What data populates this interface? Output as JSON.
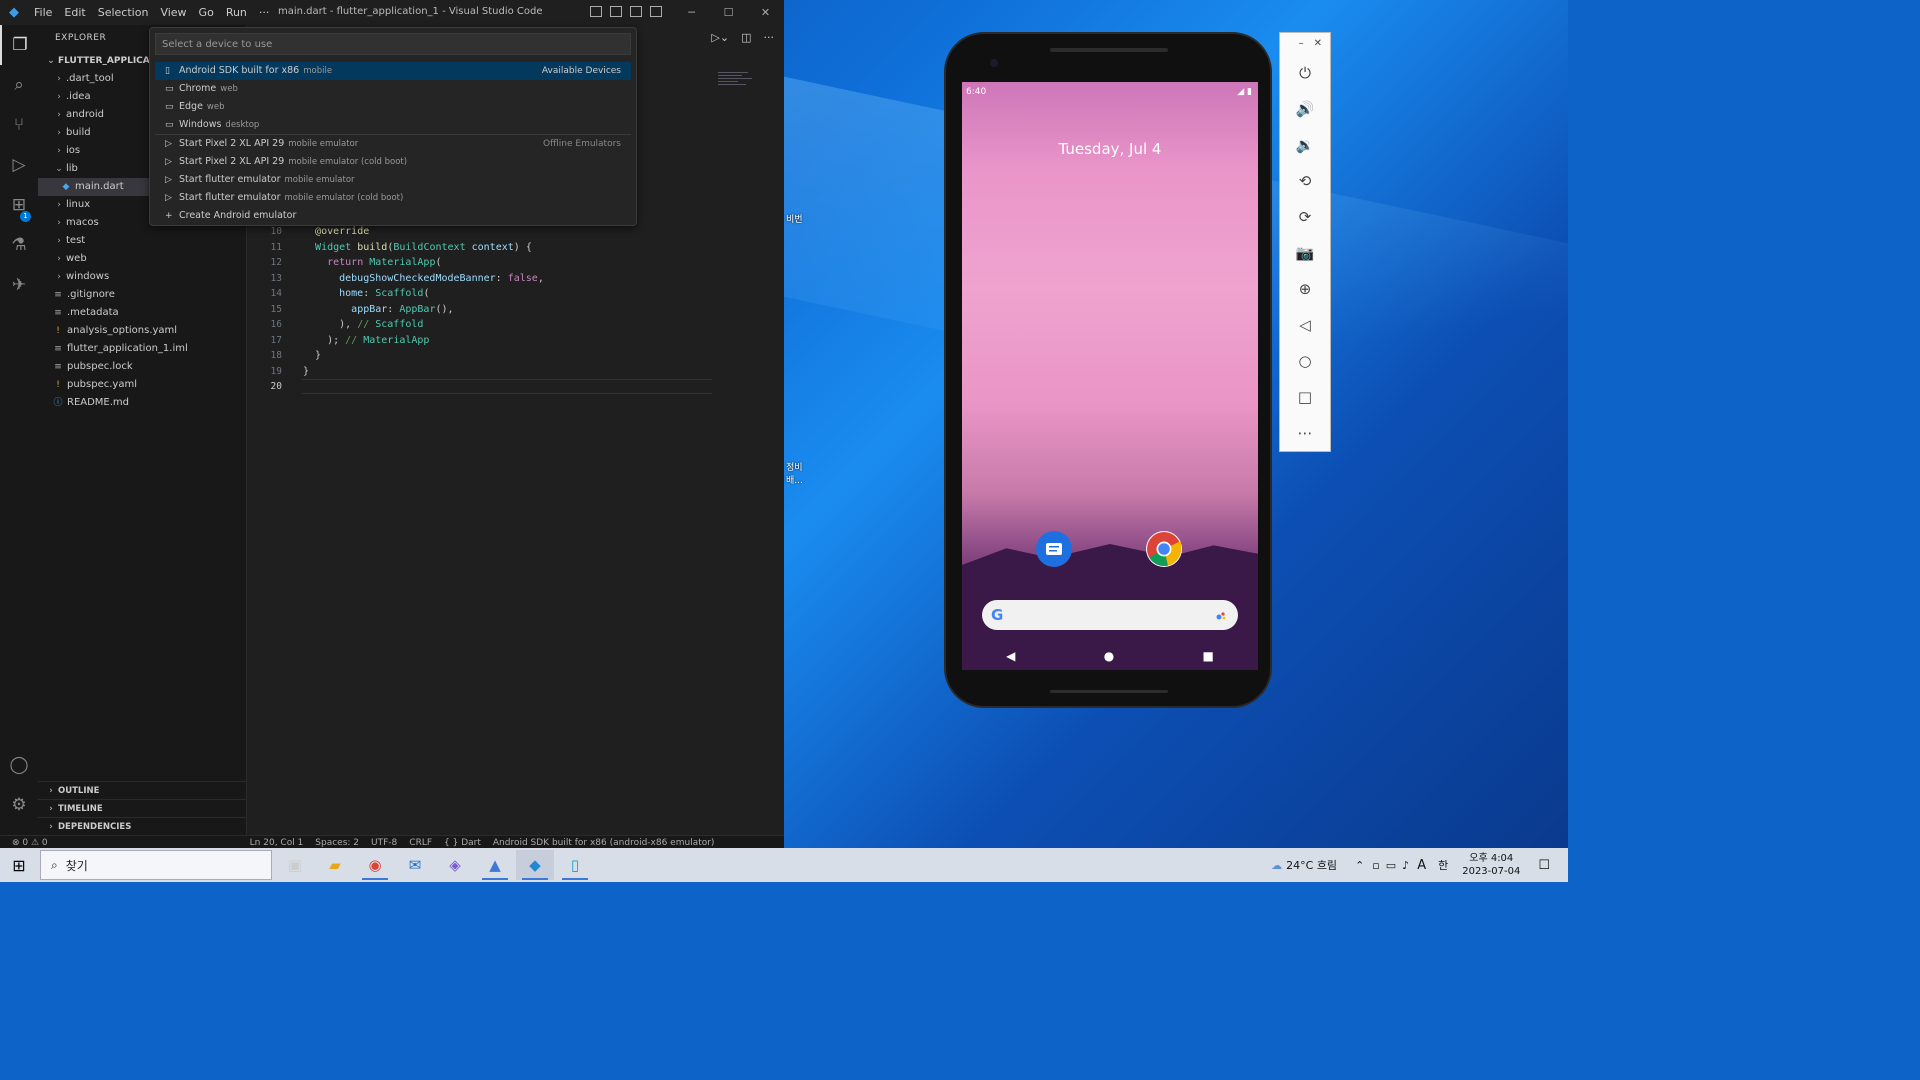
{
  "vscode": {
    "logo": "◆",
    "menu": [
      "File",
      "Edit",
      "Selection",
      "View",
      "Go",
      "Run",
      "···"
    ],
    "window_title": "main.dart - flutter_application_1 - Visual Studio Code",
    "sidebar": {
      "title": "EXPLORER",
      "project": "FLUTTER_APPLICATION_1",
      "items": [
        {
          "label": ".dart_tool",
          "type": "folder"
        },
        {
          "label": ".idea",
          "type": "folder"
        },
        {
          "label": "android",
          "type": "folder"
        },
        {
          "label": "build",
          "type": "folder"
        },
        {
          "label": "ios",
          "type": "folder"
        },
        {
          "label": "lib",
          "type": "folder-open"
        },
        {
          "label": "main.dart",
          "type": "dart"
        },
        {
          "label": "linux",
          "type": "folder"
        },
        {
          "label": "macos",
          "type": "folder"
        },
        {
          "label": "test",
          "type": "folder"
        },
        {
          "label": "web",
          "type": "folder"
        },
        {
          "label": "windows",
          "type": "folder"
        },
        {
          "label": ".gitignore",
          "type": "file"
        },
        {
          "label": ".metadata",
          "type": "file"
        },
        {
          "label": "analysis_options.yaml",
          "type": "yaml"
        },
        {
          "label": "flutter_application_1.iml",
          "type": "file"
        },
        {
          "label": "pubspec.lock",
          "type": "file"
        },
        {
          "label": "pubspec.yaml",
          "type": "yaml"
        },
        {
          "label": "README.md",
          "type": "info"
        }
      ],
      "sections": [
        "OUTLINE",
        "TIMELINE",
        "DEPENDENCIES"
      ]
    },
    "activity_badge": "1",
    "quickpick": {
      "placeholder": "Select a device to use",
      "items": [
        {
          "label": "Android SDK built for x86",
          "desc": "mobile",
          "group": "Available Devices",
          "icon": "▯"
        },
        {
          "label": "Chrome",
          "desc": "web",
          "group": "",
          "icon": "▭"
        },
        {
          "label": "Edge",
          "desc": "web",
          "group": "",
          "icon": "▭"
        },
        {
          "label": "Windows",
          "desc": "desktop",
          "group": "",
          "icon": "▭"
        },
        {
          "label": "Start Pixel 2 XL API 29",
          "desc": "mobile emulator",
          "group": "Offline Emulators",
          "icon": "▷"
        },
        {
          "label": "Start Pixel 2 XL API 29",
          "desc": "mobile emulator (cold boot)",
          "group": "",
          "icon": "▷"
        },
        {
          "label": "Start flutter emulator",
          "desc": "mobile emulator",
          "group": "",
          "icon": "▷"
        },
        {
          "label": "Start flutter emulator",
          "desc": "mobile emulator (cold boot)",
          "group": "",
          "icon": "▷"
        },
        {
          "label": "Create Android emulator",
          "desc": "",
          "group": "",
          "icon": "+"
        }
      ]
    },
    "code": [
      {
        "n": "10",
        "t": "  @override"
      },
      {
        "n": "11",
        "t": "  Widget build(BuildContext context) {"
      },
      {
        "n": "12",
        "t": "    return MaterialApp("
      },
      {
        "n": "13",
        "t": "      debugShowCheckedModeBanner: false,"
      },
      {
        "n": "14",
        "t": "      home: Scaffold("
      },
      {
        "n": "15",
        "t": "        appBar: AppBar(),"
      },
      {
        "n": "16",
        "t": "      ), // Scaffold"
      },
      {
        "n": "17",
        "t": "    ); // MaterialApp"
      },
      {
        "n": "18",
        "t": "  }"
      },
      {
        "n": "19",
        "t": "}"
      },
      {
        "n": "20",
        "t": ""
      }
    ],
    "status": {
      "errors": "⊗ 0 ⚠ 0",
      "position": "Ln 20, Col 1",
      "spaces": "Spaces: 2",
      "encoding": "UTF-8",
      "eol": "CRLF",
      "language": "{ } Dart",
      "device": "Android SDK built for x86 (android-x86 emulator)"
    }
  },
  "desktop_labels": [
    "비번",
    "정비\n배..."
  ],
  "phone": {
    "time": "6:40",
    "date": "Tuesday, Jul 4",
    "google": "G"
  },
  "emulator_buttons": [
    "power-icon",
    "volume-up-icon",
    "volume-down-icon",
    "rotate-left-icon",
    "rotate-right-icon",
    "camera-icon",
    "zoom-icon",
    "back-icon",
    "home-icon",
    "overview-icon",
    "more-icon"
  ],
  "taskbar": {
    "search_text": "찾기",
    "weather": "24°C 흐림",
    "ime": "A",
    "lang": "한",
    "time": "오후 4:04",
    "date": "2023-07-04"
  }
}
